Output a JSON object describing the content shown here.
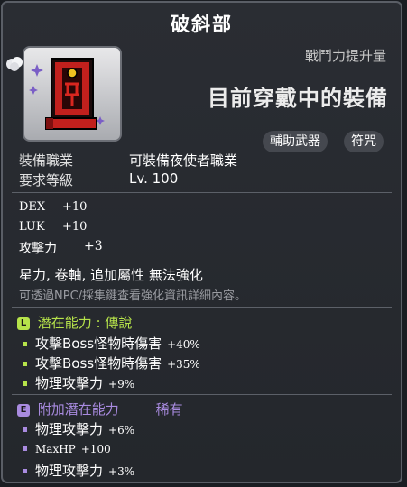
{
  "title": "破斜部",
  "icon_name": "talisman-scroll-icon",
  "combat_power": {
    "label": "戰鬥力提升量",
    "value": "目前穿戴中的裝備"
  },
  "tags": [
    "輔助武器",
    "符咒"
  ],
  "requirements": {
    "job_label": "裝備職業",
    "job_value": "可裝備夜使者職業",
    "level_label": "要求等級",
    "level_value": "Lv. 100"
  },
  "stats": [
    {
      "name": "DEX",
      "value": "+10"
    },
    {
      "name": "LUK",
      "value": "+10"
    },
    {
      "name": "攻擊力",
      "value": "+3"
    }
  ],
  "properties": "星力, 卷軸, 追加屬性 無法強化",
  "hint": "可透過NPC/採集鍵查看強化資訊詳細內容。",
  "potential": {
    "badge": "L",
    "label": "潛在能力 : 傳說",
    "color": "#b6e34a",
    "lines": [
      {
        "text": "攻擊Boss怪物時傷害",
        "value": "+40%"
      },
      {
        "text": "攻擊Boss怪物時傷害",
        "value": "+35%"
      },
      {
        "text": "物理攻擊力",
        "value": "+9%"
      }
    ]
  },
  "additional_potential": {
    "badge": "E",
    "label": "附加潛在能力",
    "grade": "稀有",
    "color": "#a98be0",
    "lines": [
      {
        "text": "物理攻擊力",
        "value": "+6%"
      },
      {
        "text": "MaxHP",
        "value": "+100"
      },
      {
        "text": "物理攻擊力",
        "value": "+3%"
      }
    ]
  }
}
